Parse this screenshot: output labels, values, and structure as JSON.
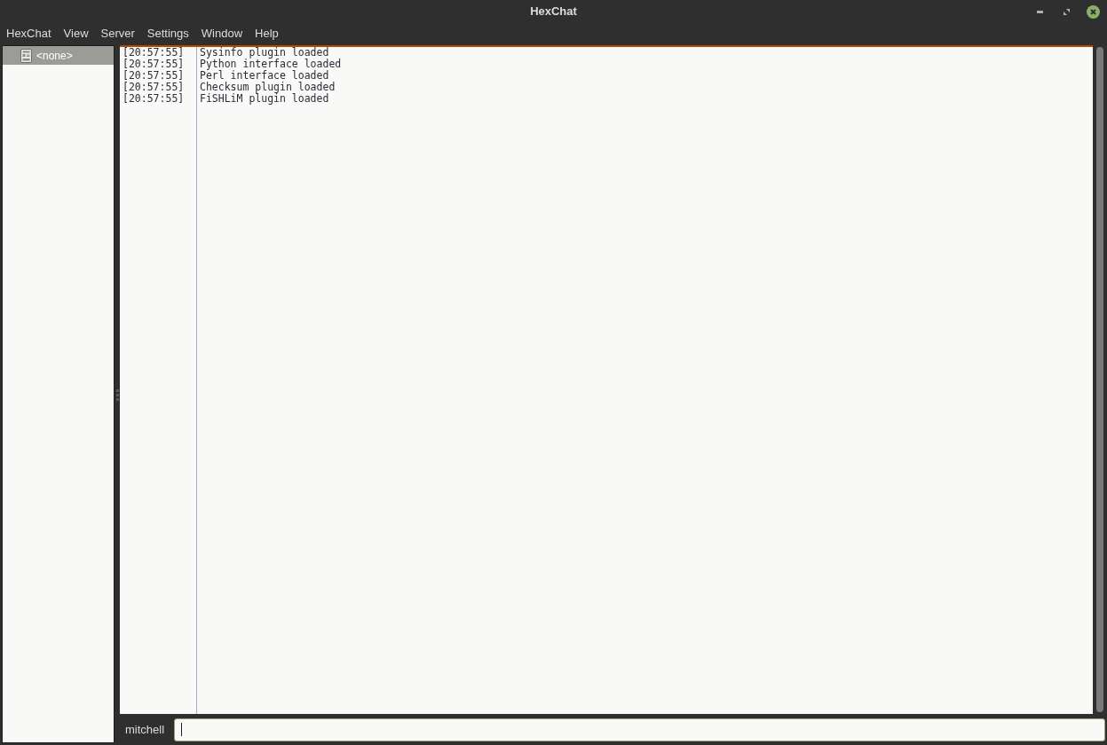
{
  "window": {
    "title": "HexChat"
  },
  "menu_bar": [
    {
      "label": "HexChat"
    },
    {
      "label": "View"
    },
    {
      "label": "Server"
    },
    {
      "label": "Settings"
    },
    {
      "label": "Window"
    },
    {
      "label": "Help"
    }
  ],
  "channel_tree": {
    "items": [
      {
        "label": "<none>",
        "selected": true
      }
    ]
  },
  "chat_log": {
    "lines": [
      {
        "time": "[20:57:55]",
        "text": "Sysinfo plugin loaded"
      },
      {
        "time": "[20:57:55]",
        "text": "Python interface loaded"
      },
      {
        "time": "[20:57:55]",
        "text": "Perl interface loaded"
      },
      {
        "time": "[20:57:55]",
        "text": "Checksum plugin loaded"
      },
      {
        "time": "[20:57:55]",
        "text": "FiSHLiM plugin loaded"
      }
    ]
  },
  "input_bar": {
    "nick": "mitchell",
    "focused": true
  }
}
